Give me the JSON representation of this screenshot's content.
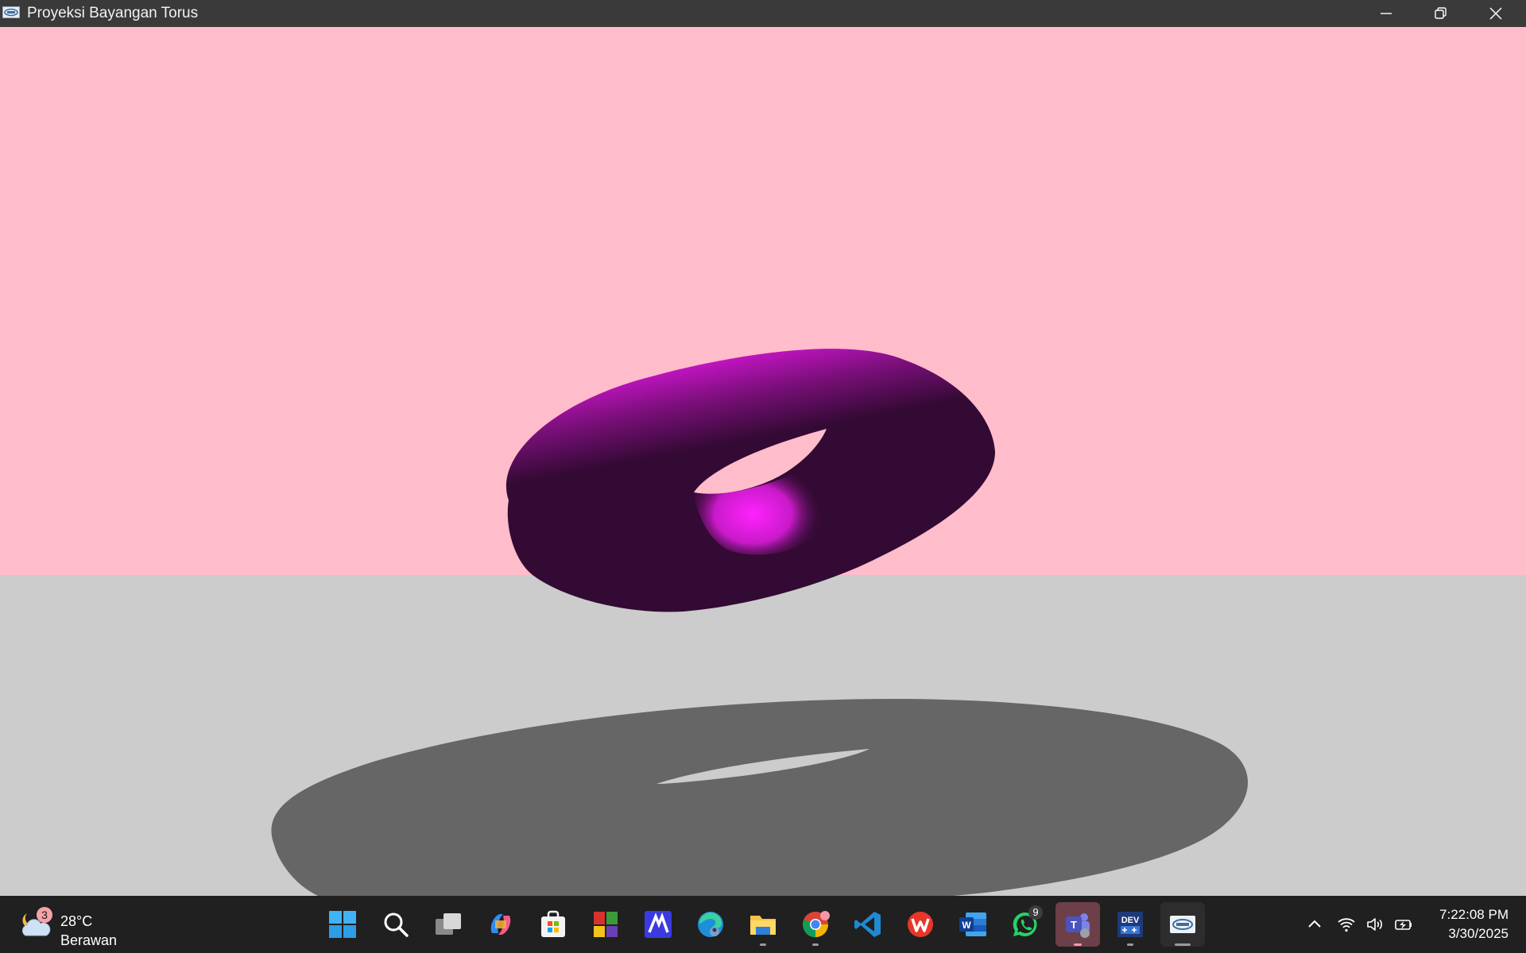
{
  "window": {
    "title": "Proyeksi Bayangan Torus",
    "app_icon": "opengl-window-icon",
    "controls": [
      "minimize-icon",
      "restore-icon",
      "close-icon"
    ]
  },
  "scene": {
    "background_color": "#ffbccb",
    "floor_color": "#cccccc",
    "torus_dark_color": "#330a33",
    "torus_highlight_color": "#ff22ff",
    "shadow_color": "#666666"
  },
  "taskbar": {
    "weather": {
      "icon": "partly-cloudy-night-icon",
      "badge": "3",
      "temperature": "28°C",
      "condition": "Berawan"
    },
    "apps": [
      {
        "name": "start-button",
        "icon": "windows-logo-icon"
      },
      {
        "name": "search-button",
        "icon": "search-icon"
      },
      {
        "name": "task-view-button",
        "icon": "task-view-icon"
      },
      {
        "name": "copilot-button",
        "icon": "copilot-icon"
      },
      {
        "name": "microsoft-store-button",
        "icon": "store-icon"
      },
      {
        "name": "app-tiles-button",
        "icon": "tiles-icon"
      },
      {
        "name": "app-m-button",
        "icon": "m-app-icon"
      },
      {
        "name": "edge-button",
        "icon": "edge-icon"
      },
      {
        "name": "file-explorer-button",
        "icon": "folder-icon"
      },
      {
        "name": "chrome-button",
        "icon": "chrome-icon"
      },
      {
        "name": "vscode-button",
        "icon": "vscode-icon"
      },
      {
        "name": "wps-office-button",
        "icon": "wps-icon"
      },
      {
        "name": "word-button",
        "icon": "word-icon",
        "label": "W"
      },
      {
        "name": "whatsapp-button",
        "icon": "whatsapp-icon",
        "badge": "9"
      },
      {
        "name": "teams-button",
        "icon": "teams-icon",
        "label": "T"
      },
      {
        "name": "dev-cpp-button",
        "icon": "dev-cpp-icon",
        "label": "DEV"
      },
      {
        "name": "opengl-app-button",
        "icon": "opengl-icon"
      }
    ],
    "tray": {
      "icons": [
        "chevron-up-icon",
        "wifi-icon",
        "volume-icon",
        "battery-charging-icon"
      ],
      "time": "7:22:08 PM",
      "date": "3/30/2025"
    }
  }
}
